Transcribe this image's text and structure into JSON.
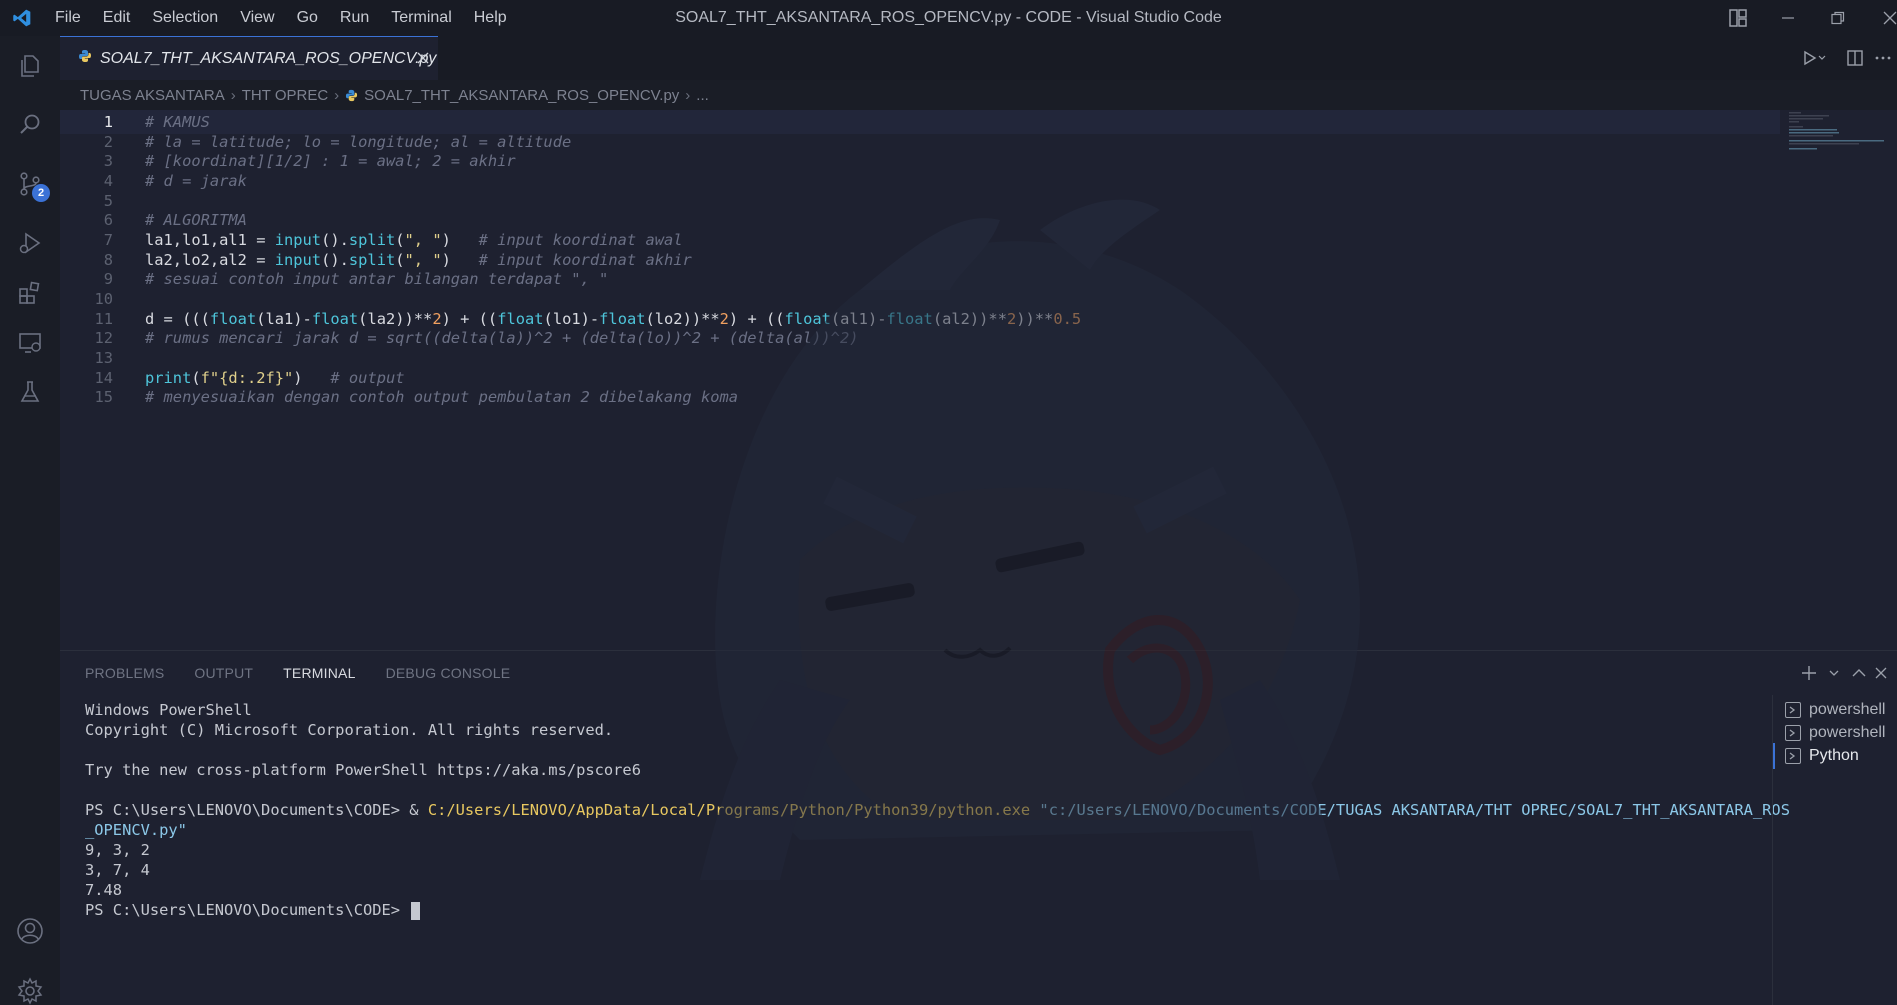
{
  "window": {
    "title": "SOAL7_THT_AKSANTARA_ROS_OPENCV.py - CODE - Visual Studio Code"
  },
  "menu": [
    "File",
    "Edit",
    "Selection",
    "View",
    "Go",
    "Run",
    "Terminal",
    "Help"
  ],
  "activity": {
    "source_control_badge": "2"
  },
  "tab": {
    "name": "SOAL7_THT_AKSANTARA_ROS_OPENCV.py"
  },
  "breadcrumbs": {
    "items": [
      "TUGAS AKSANTARA",
      "THT OPREC",
      "SOAL7_THT_AKSANTARA_ROS_OPENCV.py",
      "..."
    ]
  },
  "editor": {
    "active_line": 1,
    "lines": [
      {
        "n": "1",
        "tokens": [
          {
            "t": "# KAMUS",
            "c": "c"
          }
        ]
      },
      {
        "n": "2",
        "tokens": [
          {
            "t": "# la = latitude; lo = longitude; al = altitude",
            "c": "c"
          }
        ]
      },
      {
        "n": "3",
        "tokens": [
          {
            "t": "# [koordinat][1/2] : 1 = awal; 2 = akhir",
            "c": "c"
          }
        ]
      },
      {
        "n": "4",
        "tokens": [
          {
            "t": "# d = jarak",
            "c": "c"
          }
        ]
      },
      {
        "n": "5",
        "tokens": []
      },
      {
        "n": "6",
        "tokens": [
          {
            "t": "# ALGORITMA",
            "c": "c"
          }
        ]
      },
      {
        "n": "7",
        "tokens": [
          {
            "t": "la1,lo1,al1 = ",
            "c": "p"
          },
          {
            "t": "input",
            "c": "f"
          },
          {
            "t": "().",
            "c": "p"
          },
          {
            "t": "split",
            "c": "f"
          },
          {
            "t": "(",
            "c": "p"
          },
          {
            "t": "\", \"",
            "c": "s"
          },
          {
            "t": ")   ",
            "c": "p"
          },
          {
            "t": "# input koordinat awal",
            "c": "c"
          }
        ]
      },
      {
        "n": "8",
        "tokens": [
          {
            "t": "la2,lo2,al2 = ",
            "c": "p"
          },
          {
            "t": "input",
            "c": "f"
          },
          {
            "t": "().",
            "c": "p"
          },
          {
            "t": "split",
            "c": "f"
          },
          {
            "t": "(",
            "c": "p"
          },
          {
            "t": "\", \"",
            "c": "s"
          },
          {
            "t": ")   ",
            "c": "p"
          },
          {
            "t": "# input koordinat akhir",
            "c": "c"
          }
        ]
      },
      {
        "n": "9",
        "tokens": [
          {
            "t": "# sesuai contoh input antar bilangan terdapat \", \"",
            "c": "c"
          }
        ]
      },
      {
        "n": "10",
        "tokens": []
      },
      {
        "n": "11",
        "tokens": [
          {
            "t": "d = (((",
            "c": "p"
          },
          {
            "t": "float",
            "c": "f"
          },
          {
            "t": "(la1)-",
            "c": "p"
          },
          {
            "t": "float",
            "c": "f"
          },
          {
            "t": "(la2))**",
            "c": "p"
          },
          {
            "t": "2",
            "c": "n"
          },
          {
            "t": ") + ((",
            "c": "p"
          },
          {
            "t": "float",
            "c": "f"
          },
          {
            "t": "(lo1)-",
            "c": "p"
          },
          {
            "t": "float",
            "c": "f"
          },
          {
            "t": "(lo2))**",
            "c": "p"
          },
          {
            "t": "2",
            "c": "n"
          },
          {
            "t": ") + ((",
            "c": "p"
          },
          {
            "t": "float",
            "c": "f"
          },
          {
            "t": "(al1)-",
            "c": "p"
          },
          {
            "t": "float",
            "c": "f"
          },
          {
            "t": "(al2))**",
            "c": "p"
          },
          {
            "t": "2",
            "c": "n"
          },
          {
            "t": "))**",
            "c": "p"
          },
          {
            "t": "0.5",
            "c": "n"
          }
        ]
      },
      {
        "n": "12",
        "tokens": [
          {
            "t": "# rumus mencari jarak d = sqrt((delta(la))^2 + (delta(lo))^2 + (delta(al))^2)",
            "c": "c"
          }
        ]
      },
      {
        "n": "13",
        "tokens": []
      },
      {
        "n": "14",
        "tokens": [
          {
            "t": "print",
            "c": "f"
          },
          {
            "t": "(",
            "c": "p"
          },
          {
            "t": "f\"{d:.2f}\"",
            "c": "s"
          },
          {
            "t": ")   ",
            "c": "p"
          },
          {
            "t": "# output",
            "c": "c"
          }
        ]
      },
      {
        "n": "15",
        "tokens": [
          {
            "t": "# menyesuaikan dengan contoh output pembulatan 2 dibelakang koma",
            "c": "c"
          }
        ]
      }
    ]
  },
  "panel": {
    "tabs": [
      "PROBLEMS",
      "OUTPUT",
      "TERMINAL",
      "DEBUG CONSOLE"
    ],
    "active_tab": "TERMINAL",
    "terminal": {
      "lines": [
        [
          {
            "t": "Windows PowerShell"
          }
        ],
        [
          {
            "t": "Copyright (C) Microsoft Corporation. All rights reserved."
          }
        ],
        [
          {
            "t": ""
          }
        ],
        [
          {
            "t": "Try the new cross-platform PowerShell https://aka.ms/pscore6"
          }
        ],
        [
          {
            "t": ""
          }
        ],
        [
          {
            "t": "PS C:\\Users\\LENOVO\\Documents\\CODE> & "
          },
          {
            "t": "C:/Users/LENOVO/AppData/Local/Programs/Python/Python39/python.exe",
            "c": "cmd"
          },
          {
            "t": " "
          },
          {
            "t": "\"c:/Users/LENOVO/Documents/CODE/TUGAS AKSANTARA/THT OPREC/SOAL7_THT_AKSANTARA_ROS",
            "c": "arg"
          }
        ],
        [
          {
            "t": "_OPENCV.py\"",
            "c": "arg"
          }
        ],
        [
          {
            "t": "9, 3, 2"
          }
        ],
        [
          {
            "t": "3, 7, 4"
          }
        ],
        [
          {
            "t": "7.48"
          }
        ]
      ],
      "prompt": "PS C:\\Users\\LENOVO\\Documents\\CODE> "
    },
    "terminal_list": [
      "powershell",
      "powershell",
      "Python"
    ],
    "terminal_list_active": 2
  }
}
